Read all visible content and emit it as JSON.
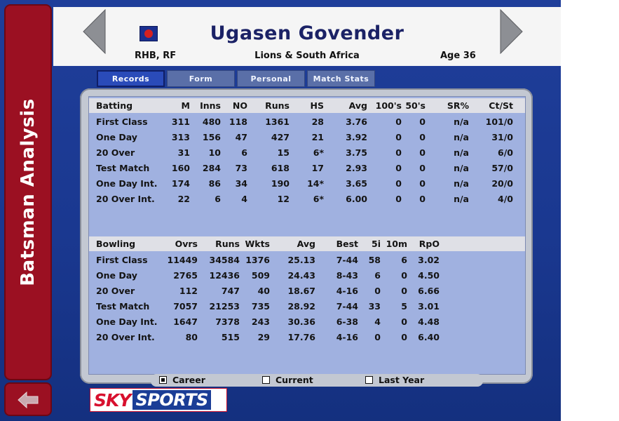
{
  "sidebar": {
    "title": "Batsman Analysis"
  },
  "header": {
    "player_name": "Ugasen Govender",
    "batting_style": "RHB, RF",
    "team": "Lions & South Africa",
    "age": "Age 36"
  },
  "tabs": [
    {
      "label": "Records",
      "active": true
    },
    {
      "label": "Form",
      "active": false
    },
    {
      "label": "Personal",
      "active": false
    },
    {
      "label": "Match Stats",
      "active": false
    }
  ],
  "batting": {
    "columns": [
      "Batting",
      "M",
      "Inns",
      "NO",
      "Runs",
      "HS",
      "Avg",
      "100's",
      "50's",
      "SR%",
      "Ct/St"
    ],
    "rows": [
      [
        "First Class",
        "311",
        "480",
        "118",
        "1361",
        "28",
        "3.76",
        "0",
        "0",
        "n/a",
        "101/0"
      ],
      [
        "One Day",
        "313",
        "156",
        "47",
        "427",
        "21",
        "3.92",
        "0",
        "0",
        "n/a",
        "31/0"
      ],
      [
        "20 Over",
        "31",
        "10",
        "6",
        "15",
        "6*",
        "3.75",
        "0",
        "0",
        "n/a",
        "6/0"
      ],
      [
        "Test Match",
        "160",
        "284",
        "73",
        "618",
        "17",
        "2.93",
        "0",
        "0",
        "n/a",
        "57/0"
      ],
      [
        "One Day Int.",
        "174",
        "86",
        "34",
        "190",
        "14*",
        "3.65",
        "0",
        "0",
        "n/a",
        "20/0"
      ],
      [
        "20 Over Int.",
        "22",
        "6",
        "4",
        "12",
        "6*",
        "6.00",
        "0",
        "0",
        "n/a",
        "4/0"
      ]
    ]
  },
  "bowling": {
    "columns": [
      "Bowling",
      "Ovrs",
      "Runs",
      "Wkts",
      "Avg",
      "Best",
      "5i",
      "10m",
      "RpO"
    ],
    "rows": [
      [
        "First Class",
        "11449",
        "34584",
        "1376",
        "25.13",
        "7-44",
        "58",
        "6",
        "3.02"
      ],
      [
        "One Day",
        "2765",
        "12436",
        "509",
        "24.43",
        "8-43",
        "6",
        "0",
        "4.50"
      ],
      [
        "20 Over",
        "112",
        "747",
        "40",
        "18.67",
        "4-16",
        "0",
        "0",
        "6.66"
      ],
      [
        "Test Match",
        "7057",
        "21253",
        "735",
        "28.92",
        "7-44",
        "33",
        "5",
        "3.01"
      ],
      [
        "One Day Int.",
        "1647",
        "7378",
        "243",
        "30.36",
        "6-38",
        "4",
        "0",
        "4.48"
      ],
      [
        "20 Over Int.",
        "80",
        "515",
        "29",
        "17.76",
        "4-16",
        "0",
        "0",
        "6.40"
      ]
    ]
  },
  "period": {
    "options": [
      {
        "label": "Career",
        "checked": true
      },
      {
        "label": "Current",
        "checked": false
      },
      {
        "label": "Last Year",
        "checked": false
      }
    ]
  },
  "logo": {
    "sky": "SKY",
    "sports": "SPORTS"
  },
  "colors": {
    "background": "#1a3890",
    "sidebar": "#9b1022",
    "table_fill": "#a0b1e0",
    "header_text": "#1b2266",
    "sky_red": "#d8102e",
    "sky_blue": "#1a3d96"
  },
  "icons": {
    "back": "left-arrow-icon",
    "prev": "prev-arrow-icon",
    "next": "next-arrow-icon",
    "player": "cricket-ball-icon"
  }
}
